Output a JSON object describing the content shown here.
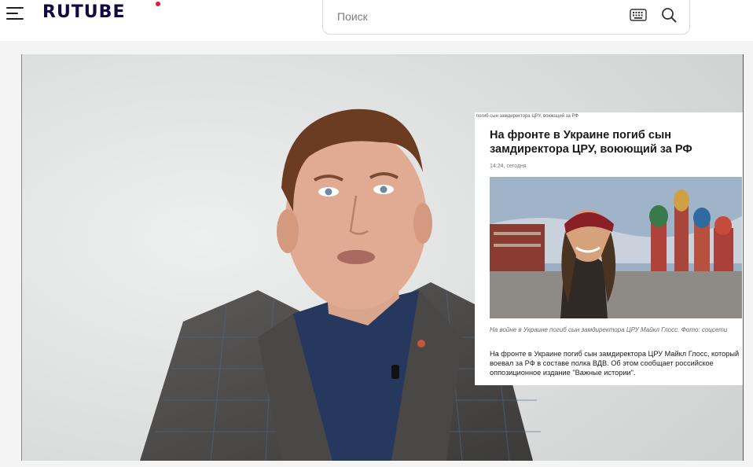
{
  "header": {
    "logo_text": "RUTUBE",
    "logo_accent_color": "#ed143b",
    "menu_icon": "hamburger-menu-icon",
    "search": {
      "placeholder": "Поиск",
      "value": "",
      "keyboard_icon": "keyboard-icon",
      "search_icon": "search-icon"
    }
  },
  "video": {
    "news_card": {
      "tag": "погиб сын замдиректора ЦРУ, воюющий за РФ",
      "headline": "На фронте в Украине погиб сын замдиректора ЦРУ, воюющий за РФ",
      "time": "14:24, сегодня",
      "caption": "На войне в Украине погиб сын замдиректора ЦРУ Майкл Глосс. Фото: соцсети",
      "body": "На фронте в Украине погиб сын замдиректора ЦРУ Майкл Глосс, который воевал за РФ в составе полка ВДВ. Об этом сообщает российское оппозиционное издание \"Важные истории\"."
    }
  }
}
